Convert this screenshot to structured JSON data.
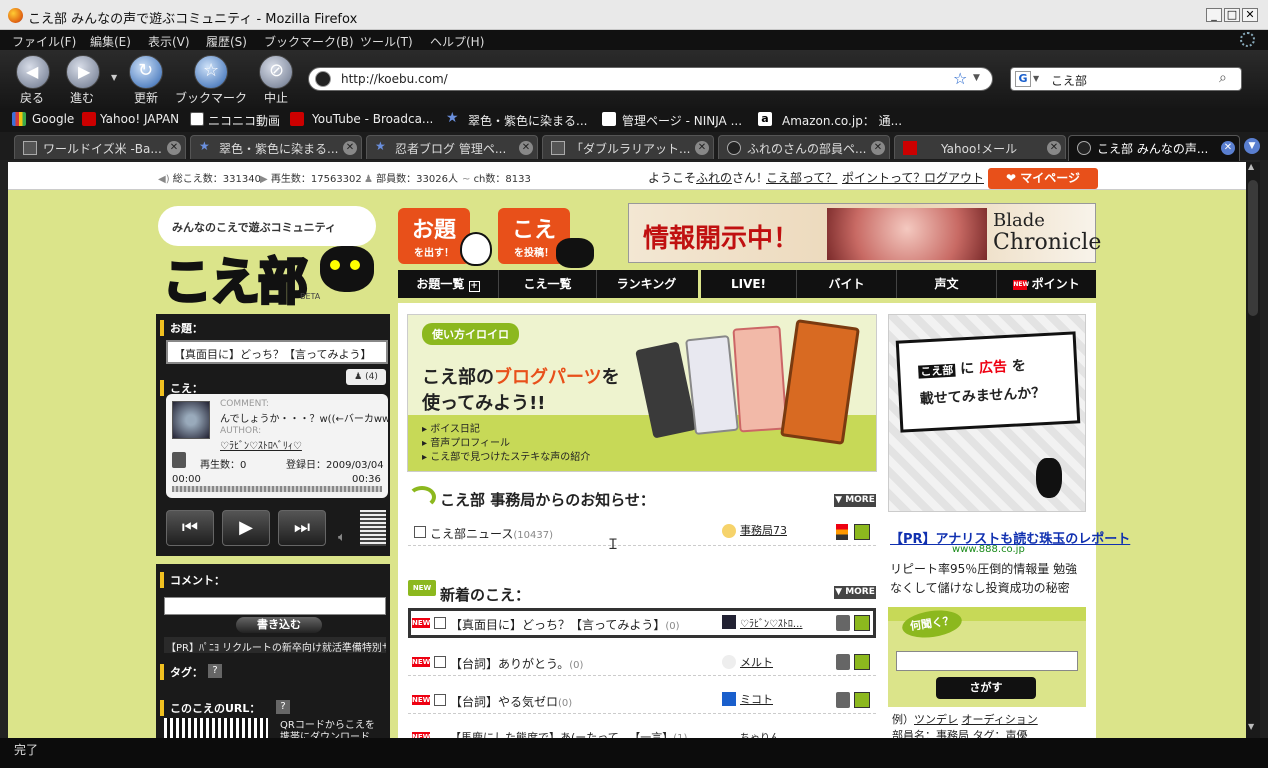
{
  "window": {
    "title": "こえ部 みんなの声で遊ぶコミュニティ - Mozilla Firefox"
  },
  "menu": [
    "ファイル(F)",
    "編集(E)",
    "表示(V)",
    "履歴(S)",
    "ブックマーク(B)",
    "ツール(T)",
    "ヘルプ(H)"
  ],
  "nav": {
    "back": "戻る",
    "forward": "進む",
    "reload": "更新",
    "bookmark": "ブックマーク",
    "stop": "中止"
  },
  "url": "http://koebu.com/",
  "search": {
    "value": "こえ部"
  },
  "bookmarks": [
    "Google",
    "Yahoo! JAPAN",
    "ニコニコ動画",
    "YouTube - Broadca...",
    "翠色・紫色に染まる...",
    "管理ページ - NINJA ...",
    "Amazon.co.jp： 通..."
  ],
  "tabs": [
    "ワールドイズ米 -Ba...",
    "翠色・紫色に染まる...",
    "忍者ブログ 管理ペ...",
    "「ダブルラリアット...",
    "ふれのさんの部員ペ...",
    "Yahoo!メール",
    "こえ部 みんなの声..."
  ],
  "status": "完了",
  "stats": {
    "total_koe": "総こえ数：331340",
    "plays": "再生数：17563302",
    "members": "部員数：33026人",
    "ch": "ch数：8133"
  },
  "header": {
    "welcome_prefix": "ようこそ",
    "user": "ふれの",
    "welcome_suffix": "さん！",
    "what": "こえ部って？",
    "points": "ポイントって？",
    "logout": "ログアウト",
    "mypage": "マイページ"
  },
  "logo": {
    "tagline": "みんなのこえで遊ぶコミュニティ",
    "text": "こえ部",
    "beta": "BETA"
  },
  "actions": {
    "odai_big": "お題",
    "odai_small": "を出す！",
    "koe_big": "こえ",
    "koe_small": "を投稿！"
  },
  "banner": {
    "text": "情報開示中！",
    "brand1": "Blade",
    "brand2": "Chronicle"
  },
  "mainnav": [
    "お題一覧",
    "こえ一覧",
    "ランキング",
    "LIVE!",
    "バイト",
    "声文",
    "ポイント"
  ],
  "left": {
    "odai_label": "お題：",
    "odai_value": "【真面目に】どっち？【言ってみよう】",
    "odai_count": "(4)",
    "koe_label": "こえ：",
    "comment_label": "COMMENT:",
    "comment_text": "んでしょうか・・・？w((←バーカww",
    "author_label": "AUTHOR:",
    "author_name": "♡ﾗﾋﾞﾝ♡ｽﾄﾛﾍﾞﾘｨ♡",
    "plays": "再生数：0",
    "date": "登録日：2009/03/04",
    "time_start": "00:00",
    "time_end": "00:36",
    "comment_head": "コメント：",
    "write_btn": "書き込む",
    "pr_text": "【PR】ﾊﾟﾆﾖ リクルートの新卒向け就活準備特別サ",
    "tag_head": "タグ：",
    "url_head": "このこえのURL：",
    "qr_text": "QRコードからこえを携帯にダウンロード"
  },
  "promo": {
    "tag": "使い方イロイロ",
    "line1a": "こえ部の",
    "line1b": "ブログパーツ",
    "line1c": "を",
    "line2": "使ってみよう!!",
    "items": [
      "ボイス日記",
      "音声プロフィール",
      "こえ部で見つけたステキな声の紹介"
    ]
  },
  "news": {
    "title": "こえ部 事務局からのお知らせ：",
    "more": "MORE",
    "item": "こえ部ニュース",
    "count": "(10437)",
    "user": "事務局73"
  },
  "newkoe": {
    "title": "新着のこえ：",
    "more": "MORE",
    "rows": [
      {
        "text": "【真面目に】どっち？【言ってみよう】",
        "count": "(0)",
        "user": "♡ﾗﾋﾞﾝ♡ｽﾄﾛ..."
      },
      {
        "text": "【台詞】ありがとう。",
        "count": "(0)",
        "user": "メルト"
      },
      {
        "text": "【台詞】やる気ゼロ",
        "count": "(0)",
        "user": "ミコト"
      },
      {
        "text": "【馬鹿にした態度で】あ(ーたって...【一言】",
        "count": "(1)",
        "user": "ちゃりん"
      }
    ]
  },
  "right": {
    "ad_koebu": "こえ部",
    "ad_ni": "に",
    "ad_koukoku": "広告",
    "ad_wo": "を",
    "ad_line2": "載せてみませんか？",
    "pr_title": "【PR】アナリストも読む珠玉のレポート",
    "pr_domain": "www.888.co.jp",
    "pr_body": "リピート率95％圧倒的情報量 勉強なくして儲けなし投資成功の秘密",
    "ask_title": "何聞く？",
    "ask_btn": "さがす",
    "ex_label": "例）",
    "ex_1": "ツンデレ",
    "ex_2": "オーディション",
    "ex_line2": "部員名：事務局  タグ：声優"
  },
  "colors": {
    "page_bg": "#dbe48a",
    "accent": "#e8501a",
    "nav_bg": "#111111"
  }
}
